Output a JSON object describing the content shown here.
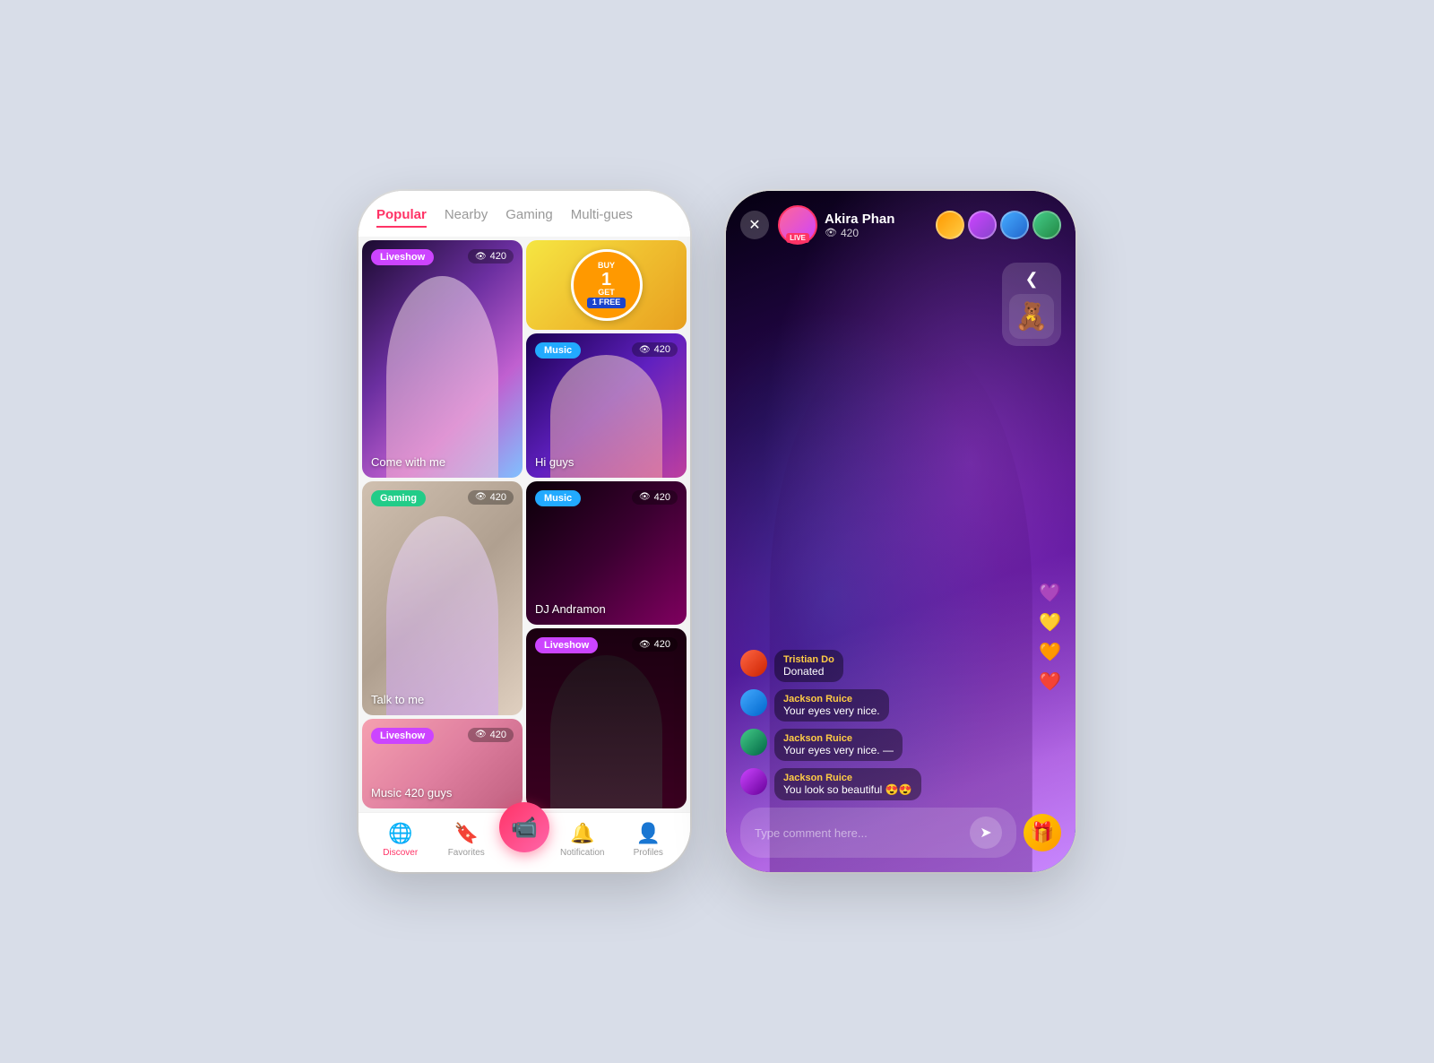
{
  "app": {
    "background": "#d8dde8"
  },
  "left_phone": {
    "tabs": [
      {
        "id": "popular",
        "label": "Popular",
        "active": true
      },
      {
        "id": "nearby",
        "label": "Nearby",
        "active": false
      },
      {
        "id": "gaming",
        "label": "Gaming",
        "active": false
      },
      {
        "id": "multi",
        "label": "Multi-gues",
        "active": false
      }
    ],
    "cards": [
      {
        "id": 1,
        "badge": "Liveshow",
        "badge_type": "liveshow",
        "views": "420",
        "title": "Come with me",
        "size": "tall"
      },
      {
        "id": 2,
        "badge": "",
        "badge_type": "promo",
        "views": "",
        "title": "",
        "size": "normal"
      },
      {
        "id": 3,
        "badge": "Music",
        "badge_type": "music",
        "views": "420",
        "title": "Hi guys",
        "size": "normal"
      },
      {
        "id": 4,
        "badge": "Gaming",
        "badge_type": "gaming",
        "views": "420",
        "title": "Talk to me",
        "size": "tall"
      },
      {
        "id": 5,
        "badge": "Music",
        "badge_type": "music",
        "views": "420",
        "title": "DJ Andramon",
        "size": "normal"
      },
      {
        "id": 6,
        "badge": "Liveshow",
        "badge_type": "liveshow",
        "views": "420",
        "title": "",
        "size": "tall"
      },
      {
        "id": 7,
        "badge": "Liveshow",
        "badge_type": "liveshow",
        "views": "420",
        "title": "Music 420 guys",
        "size": "normal"
      }
    ],
    "buy_badge": {
      "line1": "BUY",
      "line2": "1",
      "line3": "GET",
      "line4": "1",
      "line5": "FREE"
    },
    "bottom_nav": [
      {
        "id": "discover",
        "label": "Discover",
        "icon": "🌐",
        "active": true
      },
      {
        "id": "favorites",
        "label": "Favorites",
        "icon": "🔖",
        "active": false
      },
      {
        "id": "record",
        "label": "",
        "icon": "📹",
        "active": false,
        "center": true
      },
      {
        "id": "notification",
        "label": "Notification",
        "icon": "🔔",
        "active": false
      },
      {
        "id": "profiles",
        "label": "Profiles",
        "icon": "👤",
        "active": false
      }
    ]
  },
  "right_phone": {
    "host": {
      "name": "Akira Phan",
      "views": "420",
      "live_label": "LIVE"
    },
    "close_icon": "✕",
    "gift_arrow": "❮",
    "gift_emoji": "🧸",
    "chat_messages": [
      {
        "id": 1,
        "username": "Tristian Do",
        "text": "Donated",
        "avatar_class": "ca1"
      },
      {
        "id": 2,
        "username": "Jackson Ruice",
        "text": "Your eyes very nice.",
        "avatar_class": "ca2"
      },
      {
        "id": 3,
        "username": "Jackson Ruice",
        "text": "Your eyes very nice. —",
        "avatar_class": "ca3"
      },
      {
        "id": 4,
        "username": "Jackson Ruice",
        "text": "You look so beautiful 😍😍",
        "avatar_class": "ca4"
      }
    ],
    "floating_emojis": [
      "💜",
      "💛",
      "🧡",
      "❤️"
    ],
    "comment_placeholder": "Type comment here...",
    "send_icon": "➤",
    "gift_icon": "🎁"
  }
}
